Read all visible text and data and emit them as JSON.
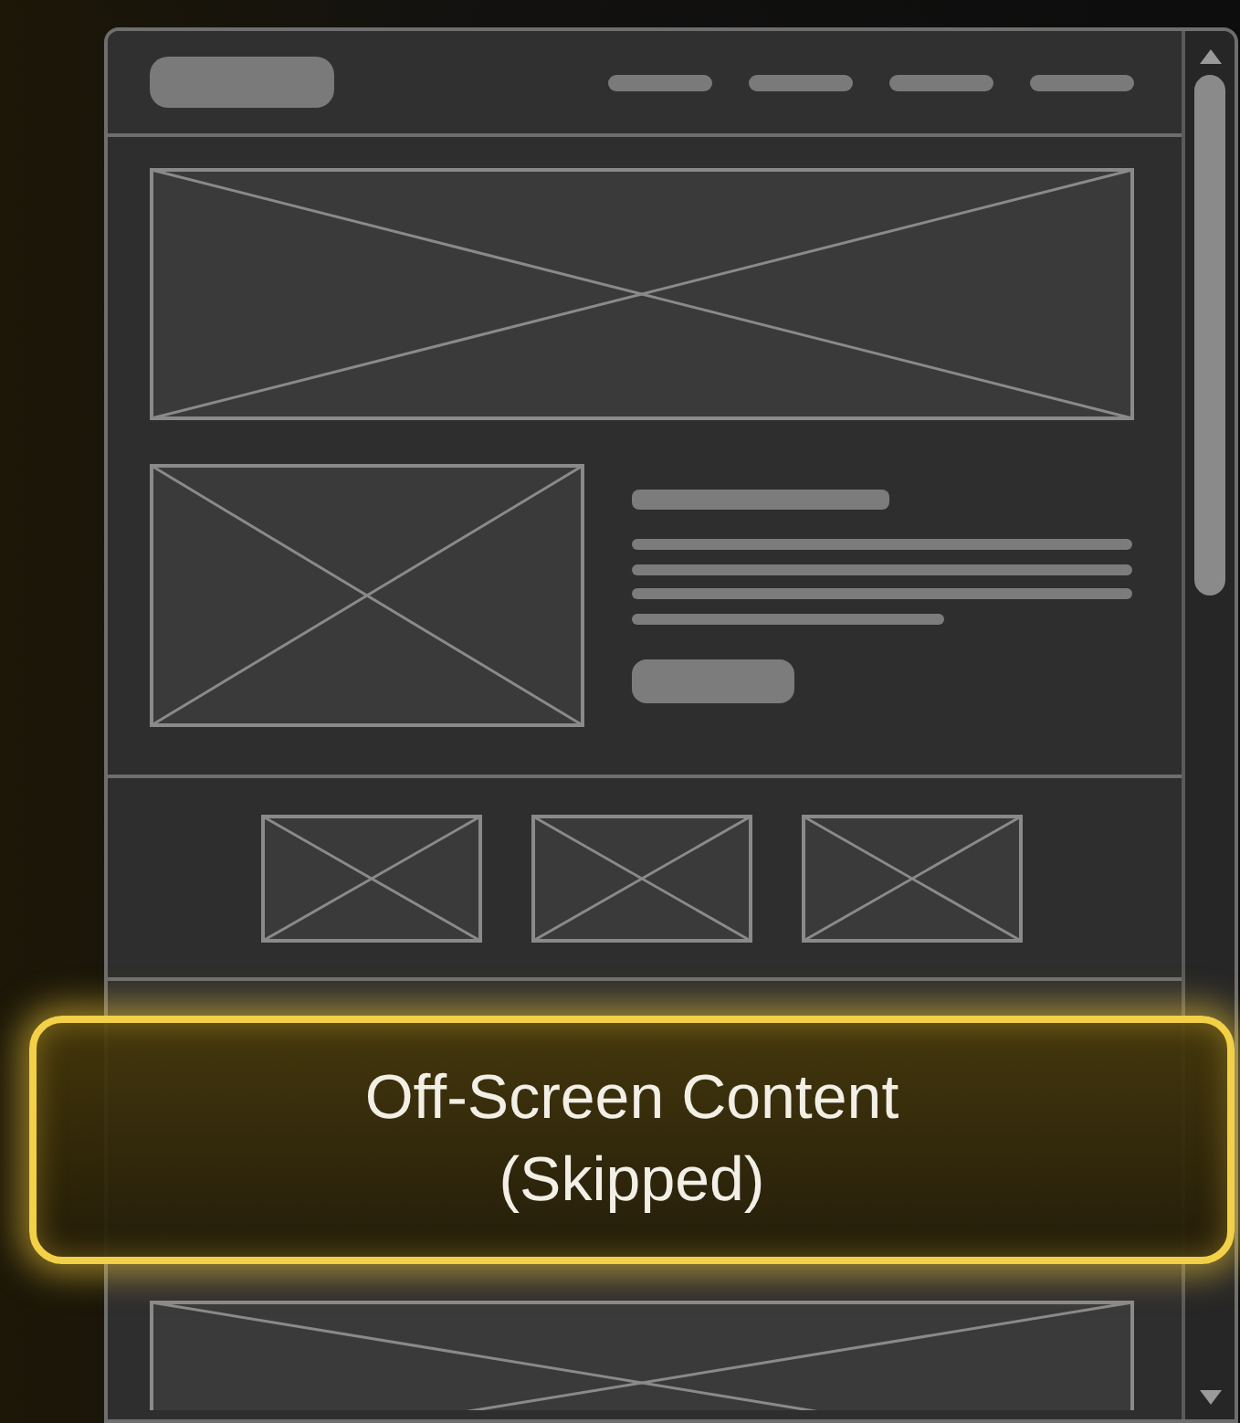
{
  "overlay": {
    "lines": [
      "Off-Screen Content",
      "(Skipped)"
    ]
  }
}
